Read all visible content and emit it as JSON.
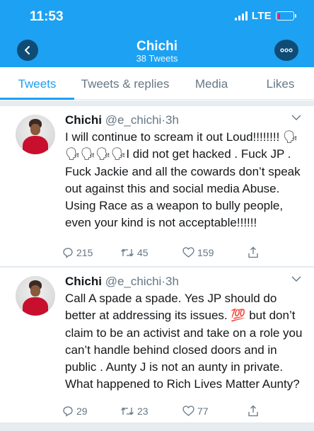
{
  "status": {
    "time": "11:53",
    "network": "LTE"
  },
  "profile": {
    "name": "Chichi",
    "tweet_count": "38 Tweets"
  },
  "tabs": [
    {
      "label": "Tweets",
      "active": true
    },
    {
      "label": "Tweets & replies",
      "active": false
    },
    {
      "label": "Media",
      "active": false
    },
    {
      "label": "Likes",
      "active": false
    }
  ],
  "tweets": [
    {
      "name": "Chichi",
      "handle": "@e_chichi",
      "separator": "·",
      "time": "3h",
      "text": "I will continue to scream it out Loud!!!!!!!! 🗣🗣🗣🗣🗣I did not get hacked . Fuck JP . Fuck Jackie and all the cowards don’t speak out against this and social media Abuse. Using Race as a weapon to bully people, even your kind is not acceptable!!!!!!",
      "replies": "215",
      "retweets": "45",
      "likes": "159"
    },
    {
      "name": "Chichi",
      "handle": "@e_chichi",
      "separator": "·",
      "time": "3h",
      "text": "Call A spade a spade. Yes JP should do better at addressing its issues. 💯 but don’t claim to be an activist and take on a role you can’t handle behind closed doors and in public . Aunty J is not an aunty in private. What happened to Rich Lives Matter Aunty?",
      "replies": "29",
      "retweets": "23",
      "likes": "77"
    }
  ],
  "colors": {
    "brand": "#1da1f2",
    "muted": "#657786",
    "battery_low": "#e0245e"
  },
  "icons": [
    "back-arrow-icon",
    "more-dots-icon",
    "reply-icon",
    "retweet-icon",
    "like-icon",
    "share-icon",
    "caret-down-icon"
  ]
}
